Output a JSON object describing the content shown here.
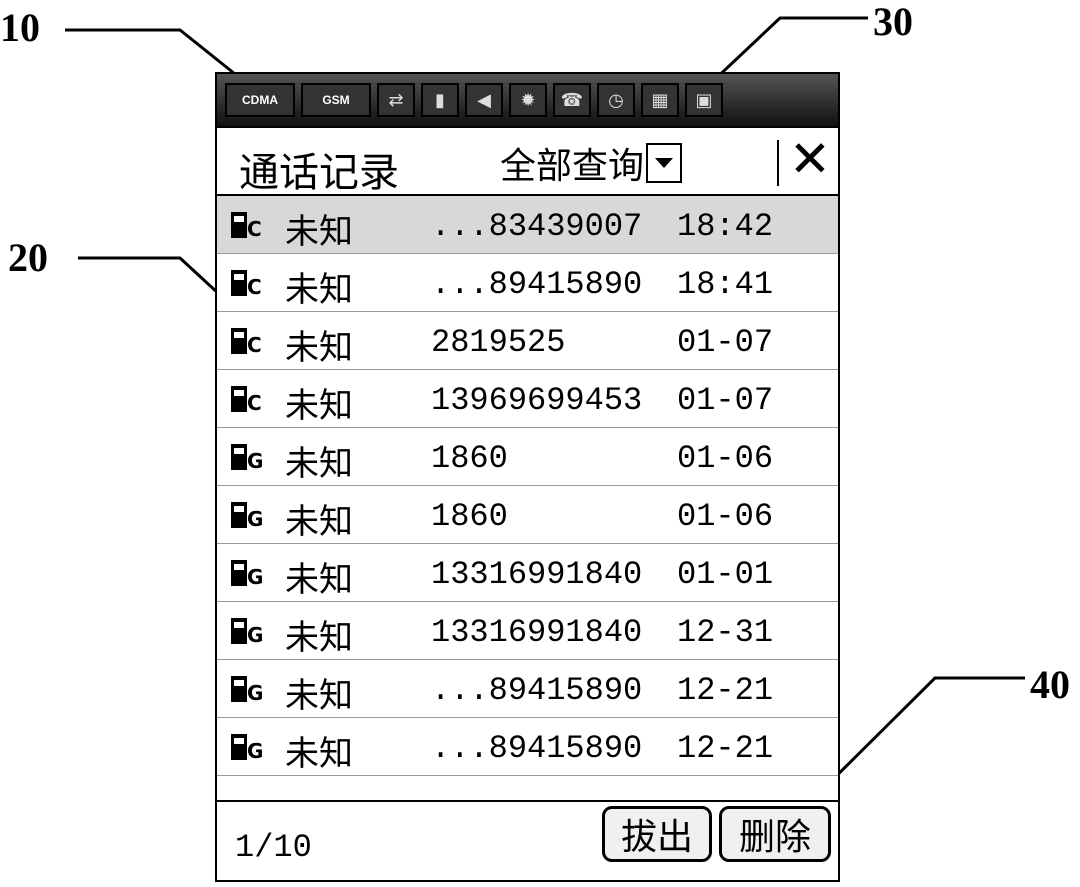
{
  "callouts": {
    "c10": "10",
    "c20": "20",
    "c30": "30",
    "c40": "40"
  },
  "statusbar": {
    "cdma": "CDMA",
    "gsm": "GSM"
  },
  "header": {
    "title": "通话记录",
    "filter": "全部查询",
    "close_glyph": "✕"
  },
  "call_log": [
    {
      "name": "未知",
      "number": "...83439007",
      "time": "18:42",
      "icon": "phone-c-icon"
    },
    {
      "name": "未知",
      "number": "...89415890",
      "time": "18:41",
      "icon": "phone-c-icon"
    },
    {
      "name": "未知",
      "number": "2819525",
      "time": "01-07",
      "icon": "phone-c-icon"
    },
    {
      "name": "未知",
      "number": "13969699453",
      "time": "01-07",
      "icon": "phone-c-icon"
    },
    {
      "name": "未知",
      "number": "1860",
      "time": "01-06",
      "icon": "phone-g-icon"
    },
    {
      "name": "未知",
      "number": "1860",
      "time": "01-06",
      "icon": "phone-g-icon"
    },
    {
      "name": "未知",
      "number": "13316991840",
      "time": "01-01",
      "icon": "phone-g-icon"
    },
    {
      "name": "未知",
      "number": "13316991840",
      "time": "12-31",
      "icon": "phone-g-icon"
    },
    {
      "name": "未知",
      "number": "...89415890",
      "time": "12-21",
      "icon": "phone-g-icon"
    },
    {
      "name": "未知",
      "number": "...89415890",
      "time": "12-21",
      "icon": "phone-g-icon"
    }
  ],
  "footer": {
    "page": "1/10",
    "dial_label": "拔出",
    "delete_label": "删除"
  }
}
